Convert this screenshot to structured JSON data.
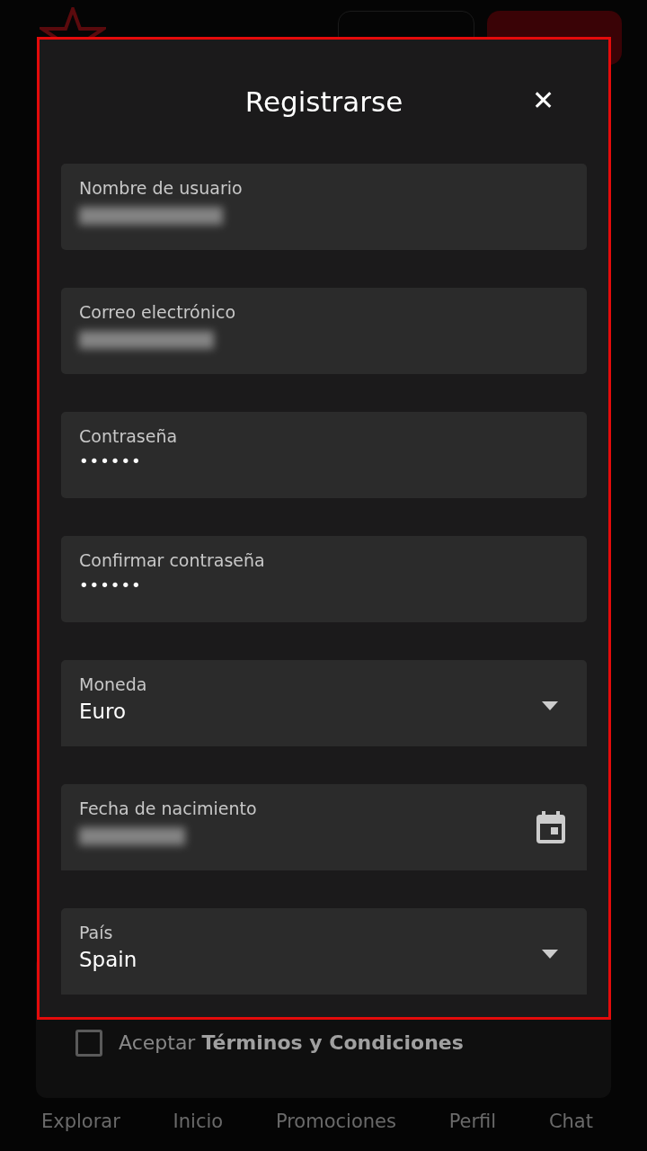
{
  "modal": {
    "title": "Registrarse",
    "close": "✕",
    "fields": [
      {
        "kind": "redacted",
        "label": "Nombre de usuario"
      },
      {
        "kind": "redacted",
        "label": "Correo electrónico"
      },
      {
        "kind": "password",
        "label": "Contraseña",
        "value": "••••••"
      },
      {
        "kind": "password",
        "label": "Confirmar contraseña",
        "value": "••••••"
      },
      {
        "kind": "select",
        "label": "Moneda",
        "value": "Euro"
      },
      {
        "kind": "date",
        "label": "Fecha de nacimiento"
      },
      {
        "kind": "select",
        "label": "País",
        "value": "Spain"
      }
    ]
  },
  "terms": {
    "checked": false,
    "text": "Aceptar **Términos y Condiciones**"
  },
  "bottom_nav": [
    {
      "label": "Explorar"
    },
    {
      "label": "Inicio"
    },
    {
      "label": "Promociones"
    },
    {
      "label": "Perfil"
    },
    {
      "label": "Chat"
    }
  ]
}
